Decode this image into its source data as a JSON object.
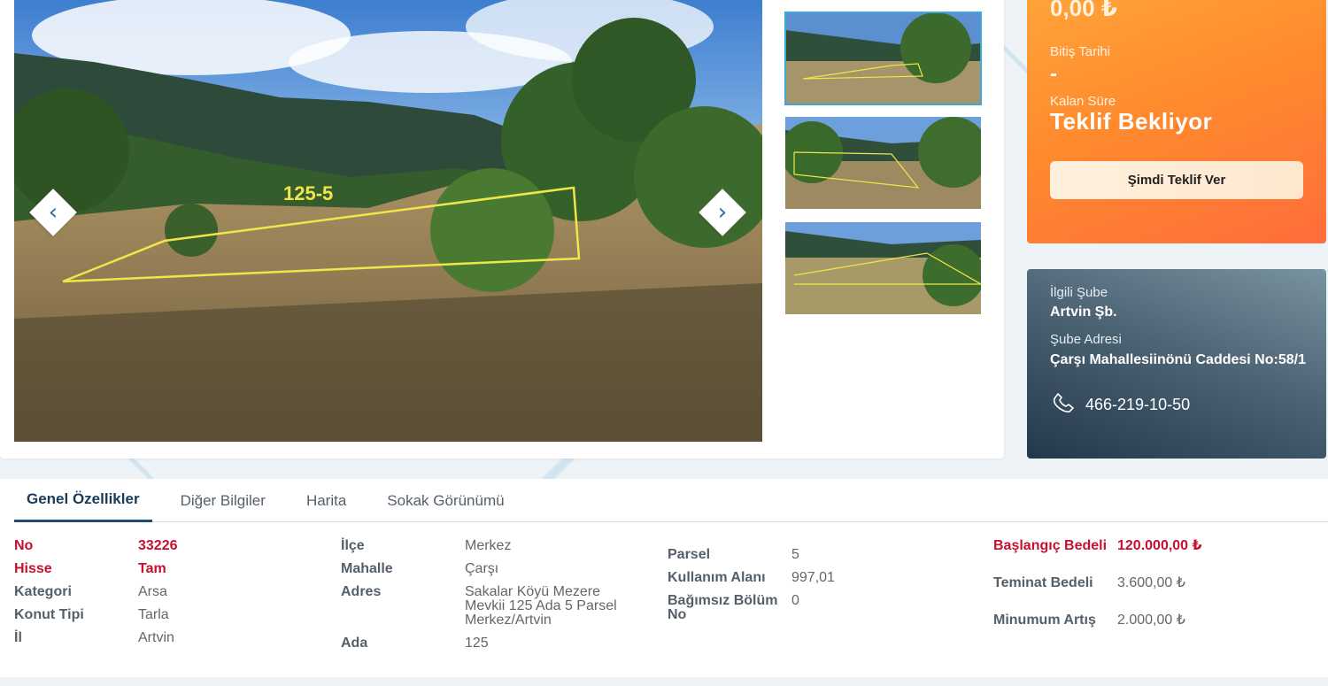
{
  "price": {
    "amount": "0,00 ₺"
  },
  "end_date": {
    "label": "Bitiş Tarihi",
    "value": "-"
  },
  "remaining": {
    "label": "Kalan Süre",
    "value": "Teklif Bekliyor"
  },
  "offer_button": "Şimdi Teklif Ver",
  "branch": {
    "label": "İlgili Şube",
    "name": "Artvin Şb.",
    "address_label": "Şube Adresi",
    "address": "Çarşı Mahallesiinönü Caddesi No:58/1",
    "phone": "466-219-10-50"
  },
  "photo_label": "125-5",
  "tabs": [
    "Genel Özellikler",
    "Diğer Bilgiler",
    "Harita",
    "Sokak Görünümü"
  ],
  "details": {
    "col1": [
      {
        "k": "No",
        "v": "33226"
      },
      {
        "k": "Hisse",
        "v": "Tam"
      },
      {
        "k": "Kategori",
        "v": "Arsa"
      },
      {
        "k": "Konut Tipi",
        "v": "Tarla"
      },
      {
        "k": "İl",
        "v": "Artvin"
      }
    ],
    "col2": [
      {
        "k": "İlçe",
        "v": "Merkez"
      },
      {
        "k": "Mahalle",
        "v": "Çarşı"
      },
      {
        "k": "Adres",
        "v": "Sakalar Köyü Mezere Mevkii 125 Ada 5 Parsel Merkez/Artvin"
      },
      {
        "k": "Ada",
        "v": "125"
      }
    ],
    "col3": [
      {
        "k": "Parsel",
        "v": "5"
      },
      {
        "k": "Kullanım Alanı",
        "v": "997,01"
      },
      {
        "k": "Bağımsız Bölüm No",
        "v": "0"
      }
    ],
    "col4": [
      {
        "k": "Başlangıç Bedeli",
        "v": "120.000,00 ₺"
      },
      {
        "k": "Teminat Bedeli",
        "v": "3.600,00 ₺"
      },
      {
        "k": "Minumum Artış",
        "v": "2.000,00 ₺"
      }
    ]
  },
  "colors": {
    "accent_orange": "#ff8a2e",
    "accent_red": "#c8102e",
    "tab_active": "#1e4b78"
  }
}
